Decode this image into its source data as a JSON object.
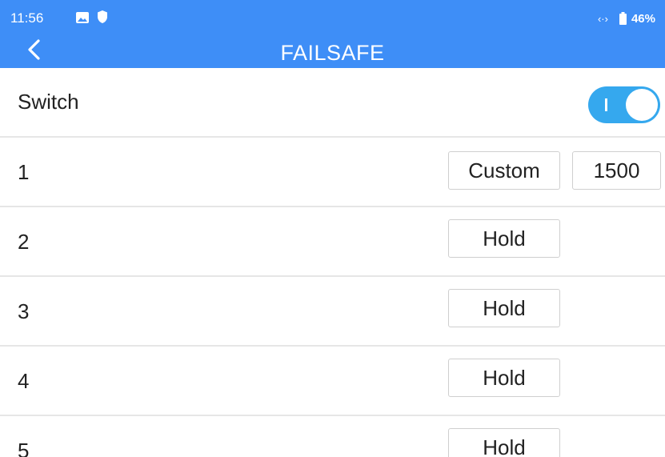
{
  "status_bar": {
    "time": "11:56",
    "battery": "46%",
    "icons": [
      "image-icon",
      "shield-icon",
      "sync-icon",
      "battery-icon"
    ]
  },
  "header": {
    "title": "FAILSAFE",
    "back_icon": "chevron-left-icon",
    "background_color": "#3e8ef7"
  },
  "switch_row": {
    "label": "Switch",
    "toggle_state": "on",
    "toggle_color": "#35a8ee"
  },
  "channels": [
    {
      "label": "1",
      "mode": "Custom",
      "value": "1500"
    },
    {
      "label": "2",
      "mode": "Hold"
    },
    {
      "label": "3",
      "mode": "Hold"
    },
    {
      "label": "4",
      "mode": "Hold"
    },
    {
      "label": "5",
      "mode": "Hold"
    }
  ]
}
